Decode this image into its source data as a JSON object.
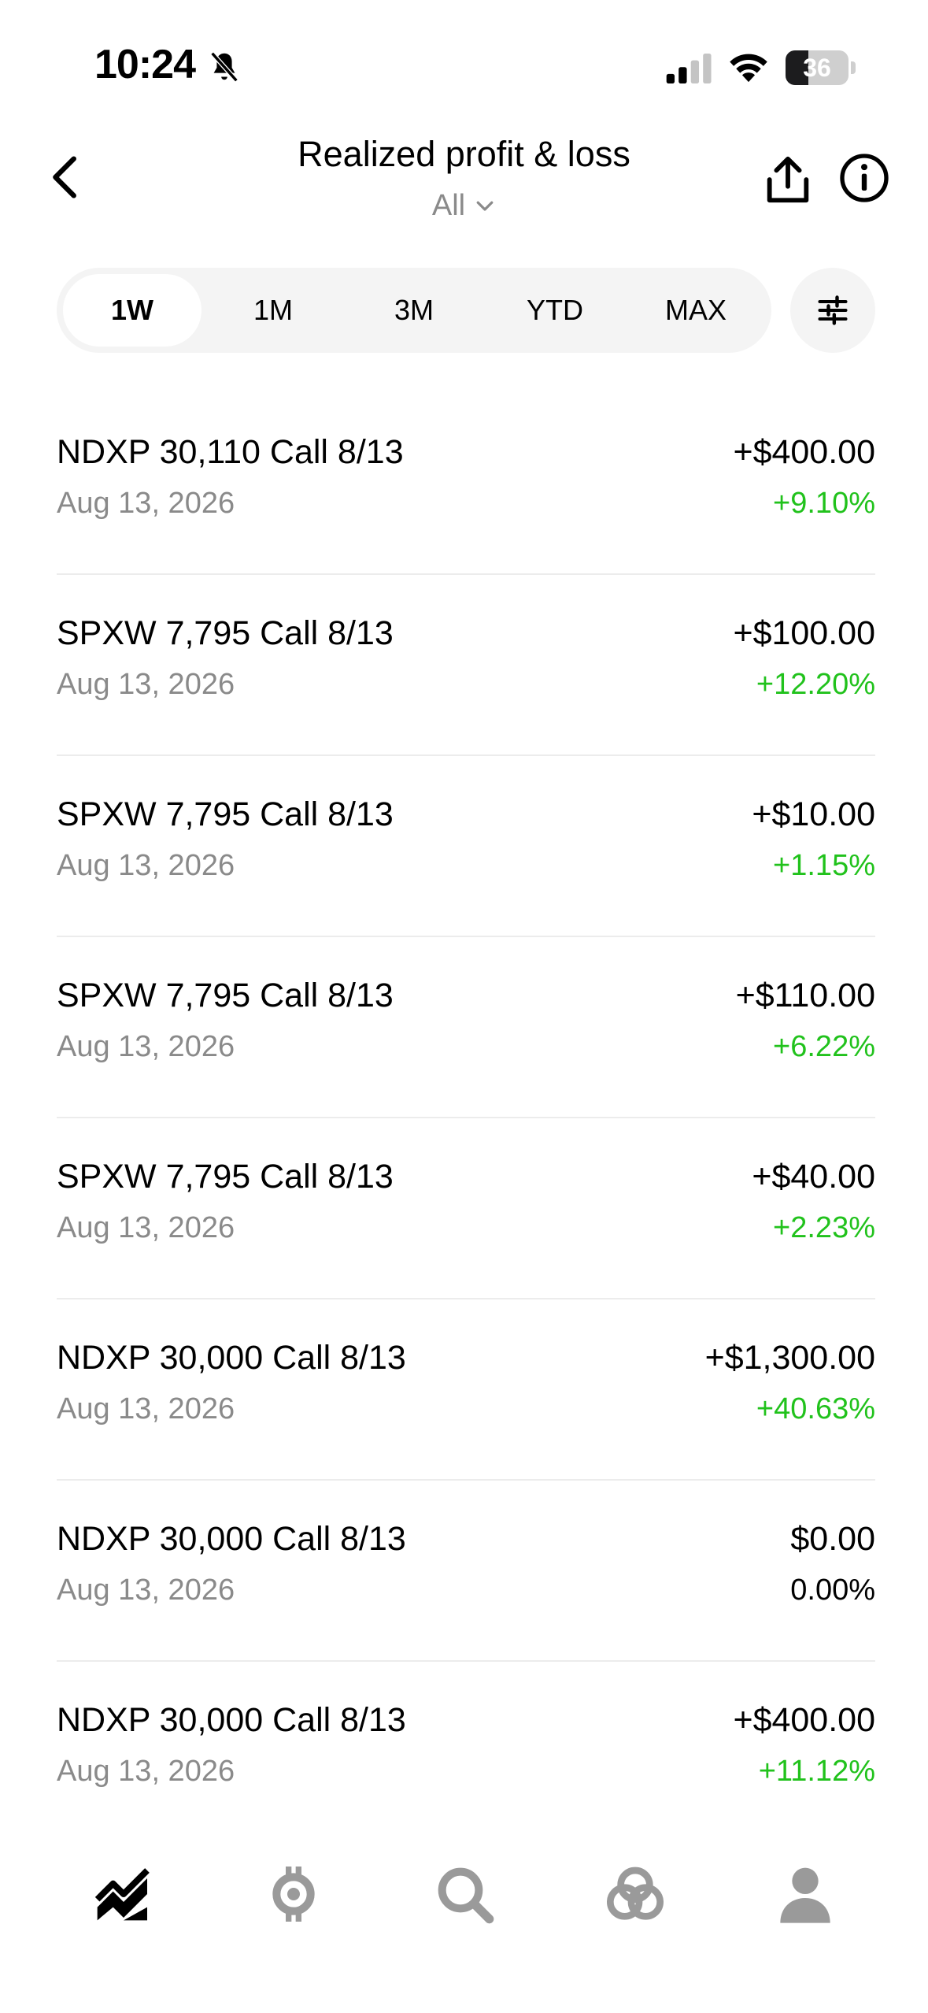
{
  "status_bar": {
    "time": "10:24",
    "battery_level": "36",
    "battery_fraction": 0.36,
    "icons": [
      "bell-slash-icon",
      "cellular-signal-icon",
      "wifi-icon",
      "battery-icon"
    ]
  },
  "header": {
    "title": "Realized profit & loss",
    "filter_label": "All",
    "icons": [
      "back-chevron-icon",
      "chevron-down-icon",
      "share-icon",
      "info-icon"
    ]
  },
  "periods": {
    "tabs": [
      "1W",
      "1M",
      "3M",
      "YTD",
      "MAX"
    ],
    "selected": "1W",
    "settings_icon": "sliders-icon"
  },
  "colors": {
    "positive": "#21c21c",
    "neutral": "#000000",
    "secondary_text": "#8a8a8a",
    "divider": "#ececec"
  },
  "rows": [
    {
      "title": "NDXP 30,110 Call 8/13",
      "date": "Aug 13, 2026",
      "amount": "+$400.00",
      "percent": "+9.10%",
      "trend": "positive"
    },
    {
      "title": "SPXW 7,795 Call 8/13",
      "date": "Aug 13, 2026",
      "amount": "+$100.00",
      "percent": "+12.20%",
      "trend": "positive"
    },
    {
      "title": "SPXW 7,795 Call 8/13",
      "date": "Aug 13, 2026",
      "amount": "+$10.00",
      "percent": "+1.15%",
      "trend": "positive"
    },
    {
      "title": "SPXW 7,795 Call 8/13",
      "date": "Aug 13, 2026",
      "amount": "+$110.00",
      "percent": "+6.22%",
      "trend": "positive"
    },
    {
      "title": "SPXW 7,795 Call 8/13",
      "date": "Aug 13, 2026",
      "amount": "+$40.00",
      "percent": "+2.23%",
      "trend": "positive"
    },
    {
      "title": "NDXP 30,000 Call 8/13",
      "date": "Aug 13, 2026",
      "amount": "+$1,300.00",
      "percent": "+40.63%",
      "trend": "positive"
    },
    {
      "title": "NDXP 30,000 Call 8/13",
      "date": "Aug 13, 2026",
      "amount": "$0.00",
      "percent": "0.00%",
      "trend": "neutral"
    },
    {
      "title": "NDXP 30,000 Call 8/13",
      "date": "Aug 13, 2026",
      "amount": "+$400.00",
      "percent": "+11.12%",
      "trend": "positive"
    }
  ],
  "bottom_nav": {
    "items": [
      "investing-icon",
      "crypto-icon",
      "search-icon",
      "network-icon",
      "account-icon"
    ],
    "active": "investing-icon"
  }
}
